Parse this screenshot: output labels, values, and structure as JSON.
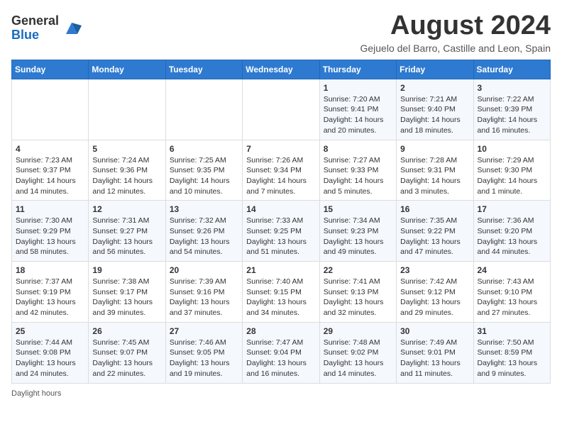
{
  "header": {
    "logo_line1": "General",
    "logo_line2": "Blue",
    "main_title": "August 2024",
    "subtitle": "Gejuelo del Barro, Castille and Leon, Spain"
  },
  "calendar": {
    "columns": [
      "Sunday",
      "Monday",
      "Tuesday",
      "Wednesday",
      "Thursday",
      "Friday",
      "Saturday"
    ],
    "rows": [
      [
        {
          "day": "",
          "info": ""
        },
        {
          "day": "",
          "info": ""
        },
        {
          "day": "",
          "info": ""
        },
        {
          "day": "",
          "info": ""
        },
        {
          "day": "1",
          "info": "Sunrise: 7:20 AM\nSunset: 9:41 PM\nDaylight: 14 hours and 20 minutes."
        },
        {
          "day": "2",
          "info": "Sunrise: 7:21 AM\nSunset: 9:40 PM\nDaylight: 14 hours and 18 minutes."
        },
        {
          "day": "3",
          "info": "Sunrise: 7:22 AM\nSunset: 9:39 PM\nDaylight: 14 hours and 16 minutes."
        }
      ],
      [
        {
          "day": "4",
          "info": "Sunrise: 7:23 AM\nSunset: 9:37 PM\nDaylight: 14 hours and 14 minutes."
        },
        {
          "day": "5",
          "info": "Sunrise: 7:24 AM\nSunset: 9:36 PM\nDaylight: 14 hours and 12 minutes."
        },
        {
          "day": "6",
          "info": "Sunrise: 7:25 AM\nSunset: 9:35 PM\nDaylight: 14 hours and 10 minutes."
        },
        {
          "day": "7",
          "info": "Sunrise: 7:26 AM\nSunset: 9:34 PM\nDaylight: 14 hours and 7 minutes."
        },
        {
          "day": "8",
          "info": "Sunrise: 7:27 AM\nSunset: 9:33 PM\nDaylight: 14 hours and 5 minutes."
        },
        {
          "day": "9",
          "info": "Sunrise: 7:28 AM\nSunset: 9:31 PM\nDaylight: 14 hours and 3 minutes."
        },
        {
          "day": "10",
          "info": "Sunrise: 7:29 AM\nSunset: 9:30 PM\nDaylight: 14 hours and 1 minute."
        }
      ],
      [
        {
          "day": "11",
          "info": "Sunrise: 7:30 AM\nSunset: 9:29 PM\nDaylight: 13 hours and 58 minutes."
        },
        {
          "day": "12",
          "info": "Sunrise: 7:31 AM\nSunset: 9:27 PM\nDaylight: 13 hours and 56 minutes."
        },
        {
          "day": "13",
          "info": "Sunrise: 7:32 AM\nSunset: 9:26 PM\nDaylight: 13 hours and 54 minutes."
        },
        {
          "day": "14",
          "info": "Sunrise: 7:33 AM\nSunset: 9:25 PM\nDaylight: 13 hours and 51 minutes."
        },
        {
          "day": "15",
          "info": "Sunrise: 7:34 AM\nSunset: 9:23 PM\nDaylight: 13 hours and 49 minutes."
        },
        {
          "day": "16",
          "info": "Sunrise: 7:35 AM\nSunset: 9:22 PM\nDaylight: 13 hours and 47 minutes."
        },
        {
          "day": "17",
          "info": "Sunrise: 7:36 AM\nSunset: 9:20 PM\nDaylight: 13 hours and 44 minutes."
        }
      ],
      [
        {
          "day": "18",
          "info": "Sunrise: 7:37 AM\nSunset: 9:19 PM\nDaylight: 13 hours and 42 minutes."
        },
        {
          "day": "19",
          "info": "Sunrise: 7:38 AM\nSunset: 9:17 PM\nDaylight: 13 hours and 39 minutes."
        },
        {
          "day": "20",
          "info": "Sunrise: 7:39 AM\nSunset: 9:16 PM\nDaylight: 13 hours and 37 minutes."
        },
        {
          "day": "21",
          "info": "Sunrise: 7:40 AM\nSunset: 9:15 PM\nDaylight: 13 hours and 34 minutes."
        },
        {
          "day": "22",
          "info": "Sunrise: 7:41 AM\nSunset: 9:13 PM\nDaylight: 13 hours and 32 minutes."
        },
        {
          "day": "23",
          "info": "Sunrise: 7:42 AM\nSunset: 9:12 PM\nDaylight: 13 hours and 29 minutes."
        },
        {
          "day": "24",
          "info": "Sunrise: 7:43 AM\nSunset: 9:10 PM\nDaylight: 13 hours and 27 minutes."
        }
      ],
      [
        {
          "day": "25",
          "info": "Sunrise: 7:44 AM\nSunset: 9:08 PM\nDaylight: 13 hours and 24 minutes."
        },
        {
          "day": "26",
          "info": "Sunrise: 7:45 AM\nSunset: 9:07 PM\nDaylight: 13 hours and 22 minutes."
        },
        {
          "day": "27",
          "info": "Sunrise: 7:46 AM\nSunset: 9:05 PM\nDaylight: 13 hours and 19 minutes."
        },
        {
          "day": "28",
          "info": "Sunrise: 7:47 AM\nSunset: 9:04 PM\nDaylight: 13 hours and 16 minutes."
        },
        {
          "day": "29",
          "info": "Sunrise: 7:48 AM\nSunset: 9:02 PM\nDaylight: 13 hours and 14 minutes."
        },
        {
          "day": "30",
          "info": "Sunrise: 7:49 AM\nSunset: 9:01 PM\nDaylight: 13 hours and 11 minutes."
        },
        {
          "day": "31",
          "info": "Sunrise: 7:50 AM\nSunset: 8:59 PM\nDaylight: 13 hours and 9 minutes."
        }
      ]
    ]
  },
  "footer": {
    "daylight_label": "Daylight hours"
  }
}
